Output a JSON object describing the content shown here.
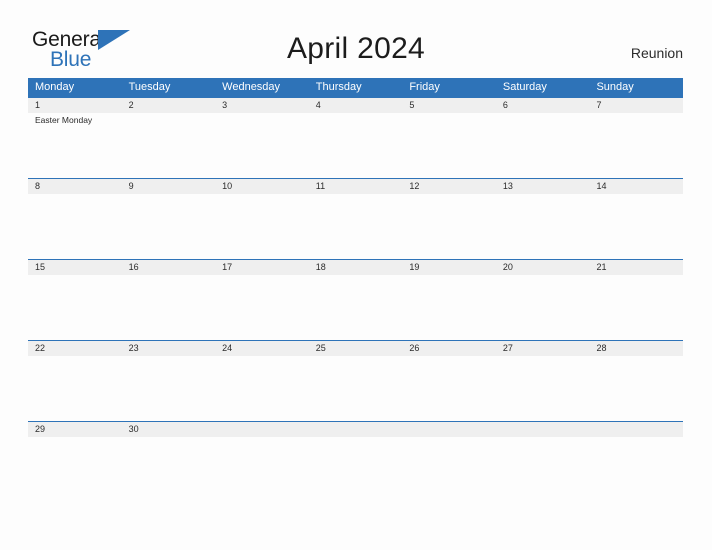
{
  "brand": {
    "name_part1": "General",
    "name_part2": "Blue",
    "accent_color": "#2e73b8"
  },
  "header": {
    "title": "April 2024",
    "region": "Reunion"
  },
  "calendar": {
    "weekdays": [
      "Monday",
      "Tuesday",
      "Wednesday",
      "Thursday",
      "Friday",
      "Saturday",
      "Sunday"
    ],
    "header_bg": "#2e73b8",
    "date_band_bg": "#efefef",
    "weeks": [
      {
        "days": [
          {
            "date": "1",
            "events": [
              "Easter Monday"
            ]
          },
          {
            "date": "2",
            "events": []
          },
          {
            "date": "3",
            "events": []
          },
          {
            "date": "4",
            "events": []
          },
          {
            "date": "5",
            "events": []
          },
          {
            "date": "6",
            "events": []
          },
          {
            "date": "7",
            "events": []
          }
        ]
      },
      {
        "days": [
          {
            "date": "8",
            "events": []
          },
          {
            "date": "9",
            "events": []
          },
          {
            "date": "10",
            "events": []
          },
          {
            "date": "11",
            "events": []
          },
          {
            "date": "12",
            "events": []
          },
          {
            "date": "13",
            "events": []
          },
          {
            "date": "14",
            "events": []
          }
        ]
      },
      {
        "days": [
          {
            "date": "15",
            "events": []
          },
          {
            "date": "16",
            "events": []
          },
          {
            "date": "17",
            "events": []
          },
          {
            "date": "18",
            "events": []
          },
          {
            "date": "19",
            "events": []
          },
          {
            "date": "20",
            "events": []
          },
          {
            "date": "21",
            "events": []
          }
        ]
      },
      {
        "days": [
          {
            "date": "22",
            "events": []
          },
          {
            "date": "23",
            "events": []
          },
          {
            "date": "24",
            "events": []
          },
          {
            "date": "25",
            "events": []
          },
          {
            "date": "26",
            "events": []
          },
          {
            "date": "27",
            "events": []
          },
          {
            "date": "28",
            "events": []
          }
        ]
      },
      {
        "days": [
          {
            "date": "29",
            "events": []
          },
          {
            "date": "30",
            "events": []
          },
          {
            "date": "",
            "events": []
          },
          {
            "date": "",
            "events": []
          },
          {
            "date": "",
            "events": []
          },
          {
            "date": "",
            "events": []
          },
          {
            "date": "",
            "events": []
          }
        ]
      }
    ]
  }
}
